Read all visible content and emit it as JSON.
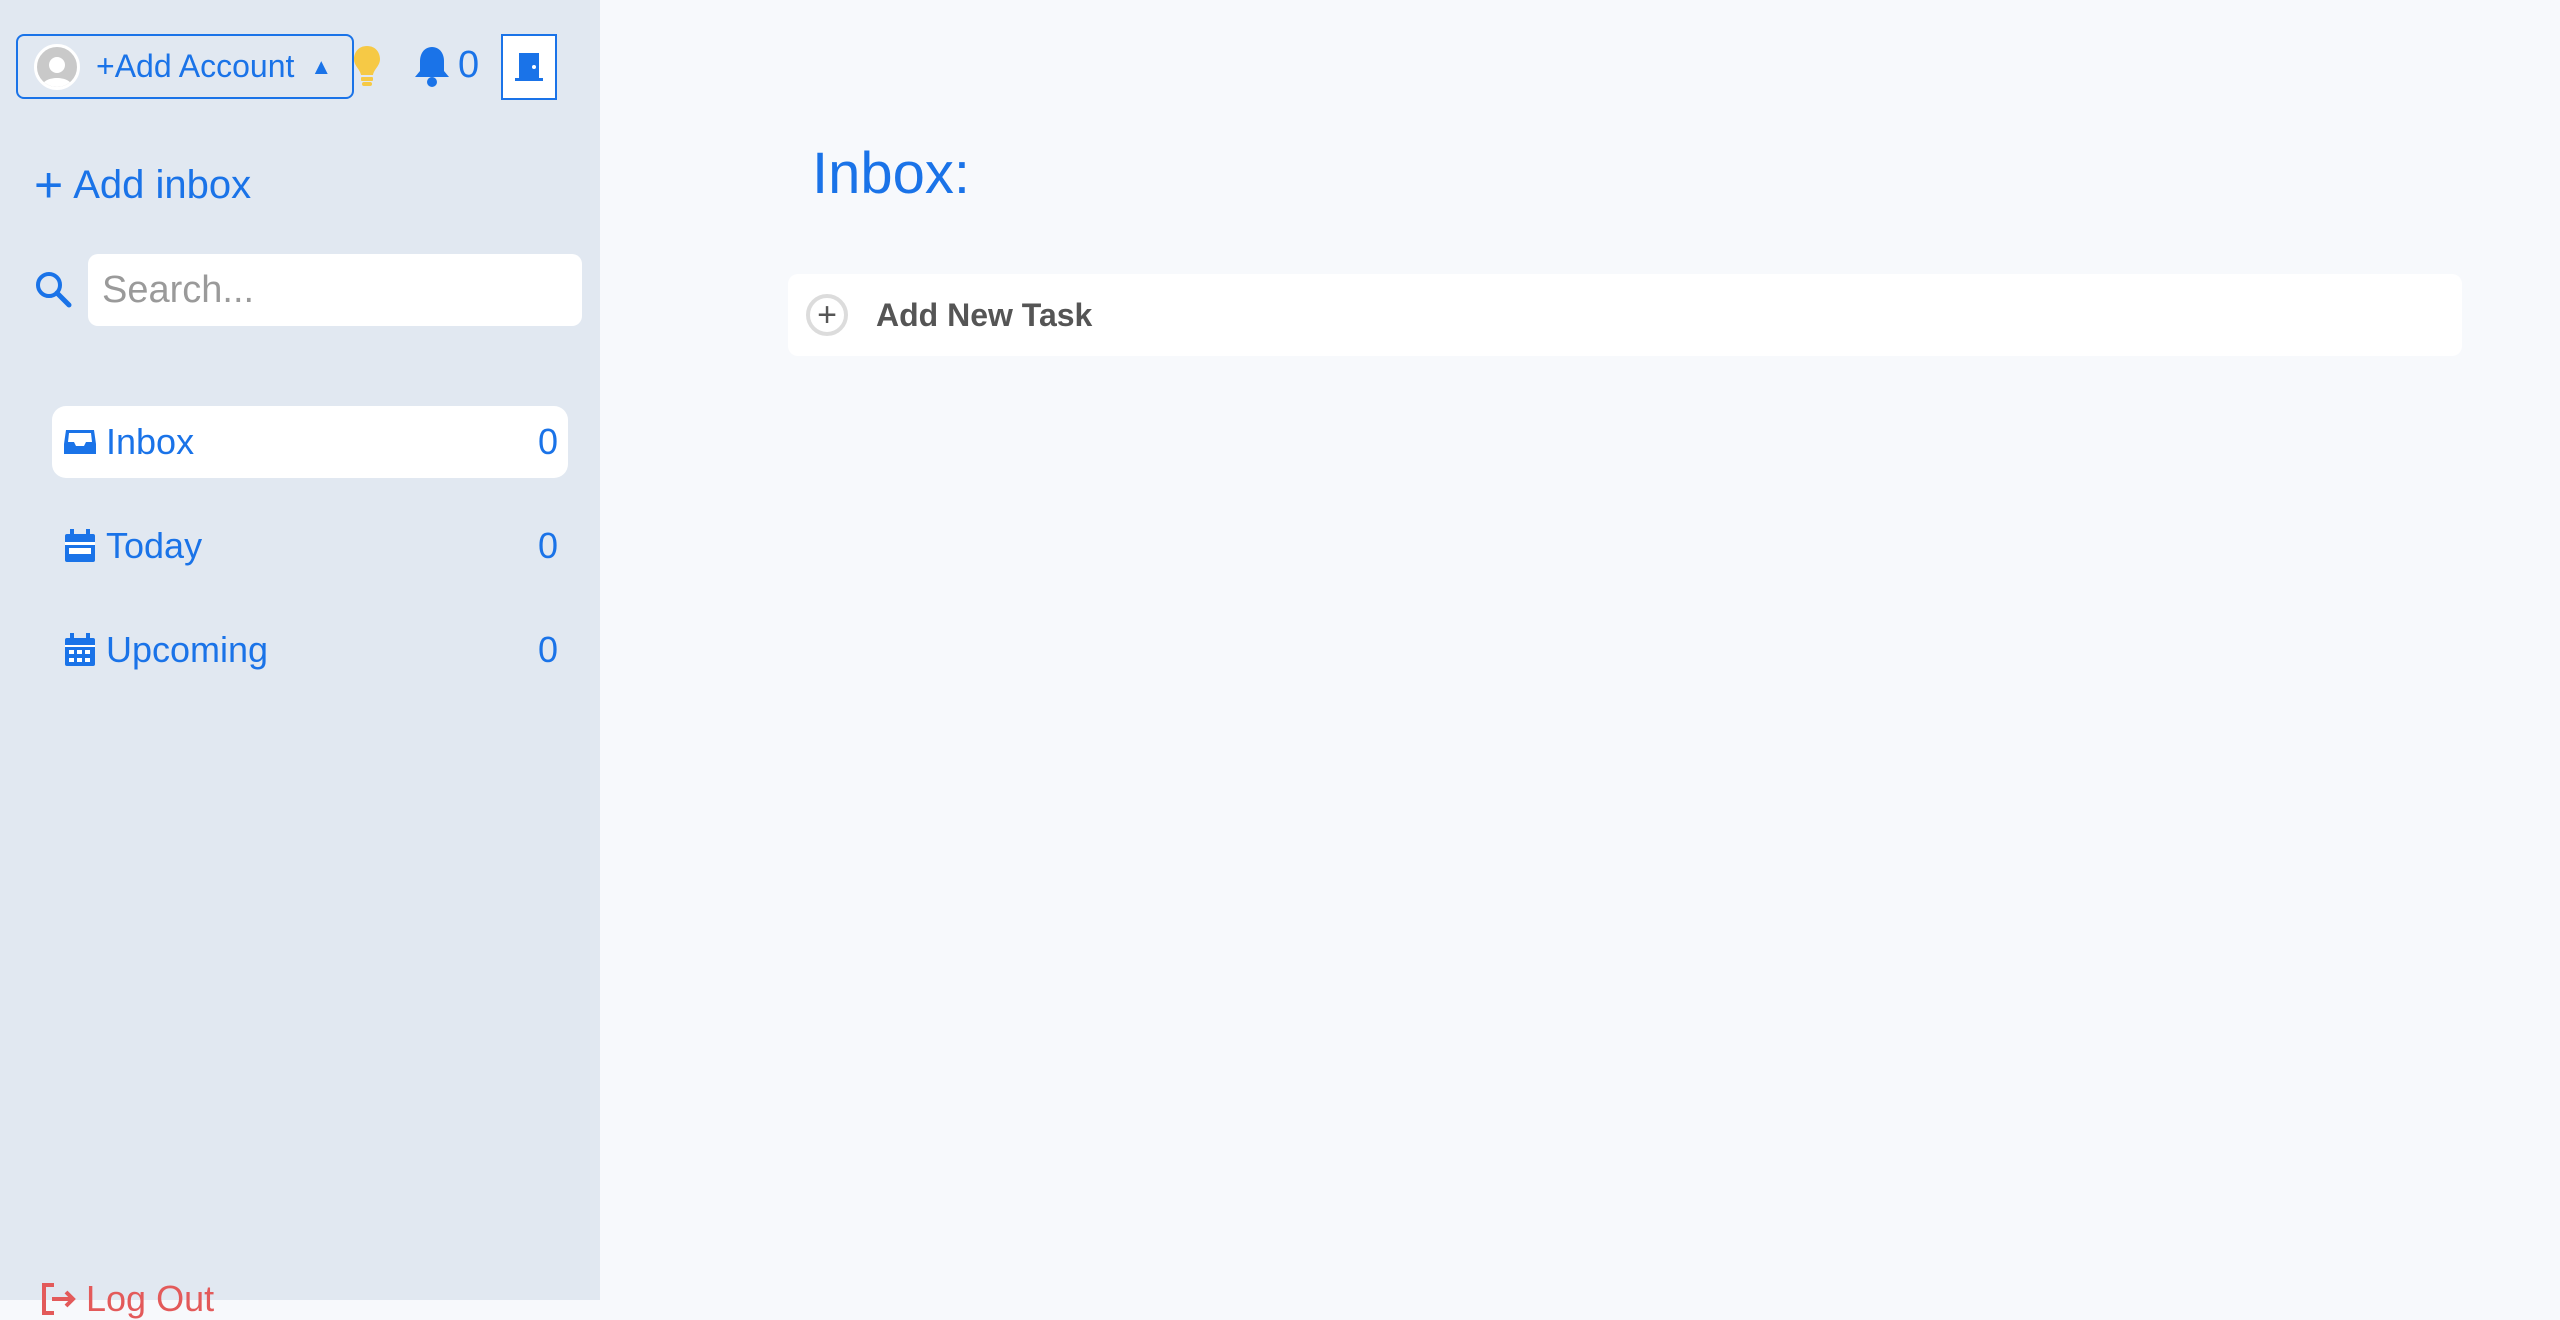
{
  "header": {
    "account_label": "+Add Account",
    "notification_count": "0"
  },
  "sidebar": {
    "add_inbox_label": "Add inbox",
    "search_placeholder": "Search...",
    "items": [
      {
        "label": "Inbox",
        "count": "0",
        "icon": "inbox-icon",
        "active": true
      },
      {
        "label": "Today",
        "count": "0",
        "icon": "calendar-day-icon",
        "active": false
      },
      {
        "label": "Upcoming",
        "count": "0",
        "icon": "calendar-week-icon",
        "active": false
      }
    ],
    "logout_label": "Log Out"
  },
  "main": {
    "title": "Inbox:",
    "add_task_label": "Add New Task"
  },
  "colors": {
    "accent": "#1a73e8",
    "sidebar_bg": "#e1e8f1",
    "main_bg": "#f7f9fc",
    "logout": "#e35a5a"
  }
}
